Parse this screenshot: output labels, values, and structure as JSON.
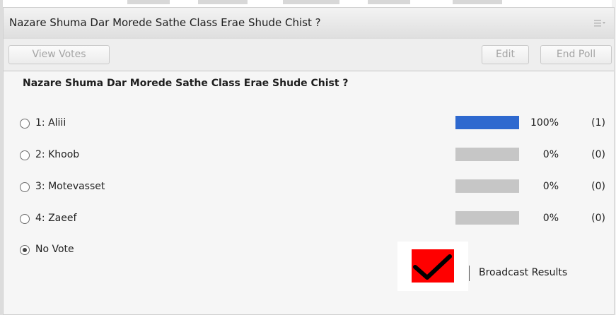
{
  "window": {
    "title": "Nazare Shuma Dar Morede Sathe Class Erae Shude Chist ?",
    "menu_icon": "hamburger-menu-icon"
  },
  "toolbar": {
    "view_votes_label": "View Votes",
    "edit_label": "Edit",
    "end_poll_label": "End Poll"
  },
  "poll": {
    "question": "Nazare Shuma Dar Morede Sathe Class Erae Shude Chist ?",
    "options": [
      {
        "label": "1: Aliii",
        "percent": "100%",
        "count": "(1)",
        "fraction": 1.0
      },
      {
        "label": "2: Khoob",
        "percent": "0%",
        "count": "(0)",
        "fraction": 0.0
      },
      {
        "label": "3: Motevasset",
        "percent": "0%",
        "count": "(0)",
        "fraction": 0.0
      },
      {
        "label": "4: Zaeef",
        "percent": "0%",
        "count": "(0)",
        "fraction": 0.0
      }
    ],
    "no_vote_label": "No Vote",
    "selected": "No Vote"
  },
  "broadcast": {
    "label": "Broadcast Results",
    "checked": true
  },
  "colors": {
    "bar_fill": "#2e69cf",
    "bar_track": "#c6c6c6",
    "checkbox_bg": "#ff0000",
    "checkmark": "#000000"
  }
}
